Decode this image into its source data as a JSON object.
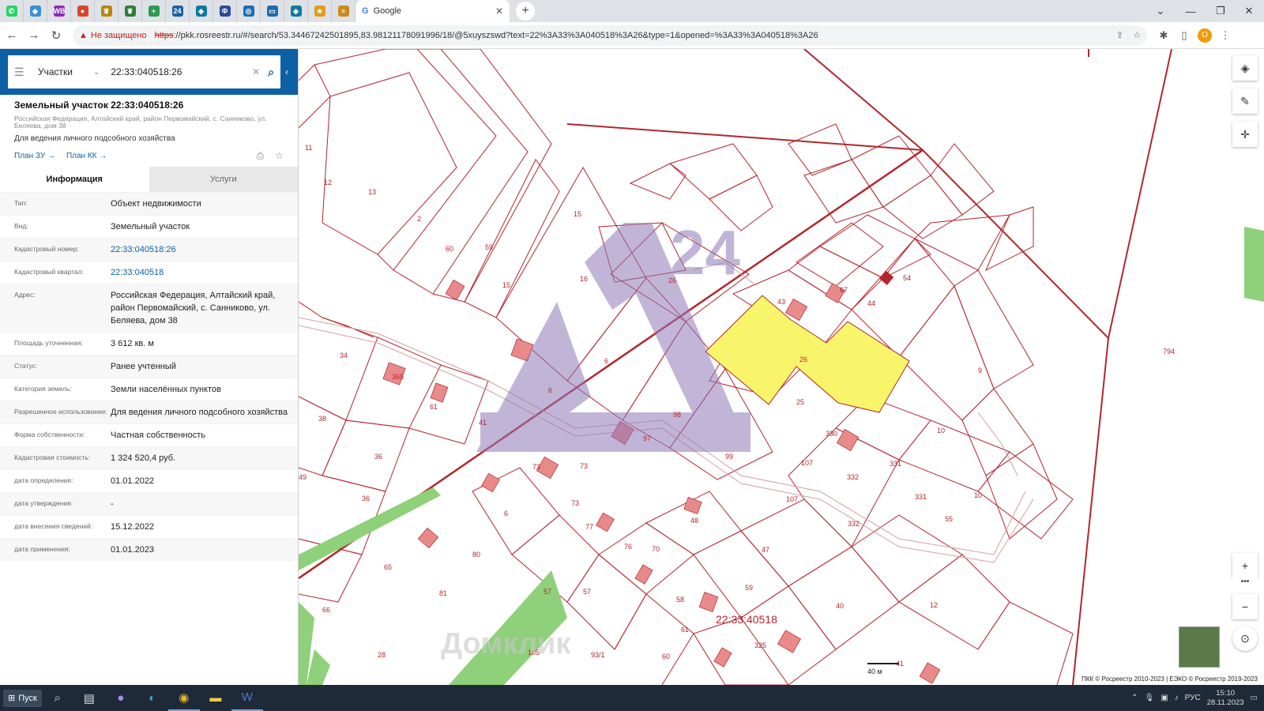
{
  "browser": {
    "tabs": [
      {
        "icon": "whatsapp-icon",
        "color": "#25d366",
        "glyph": "✆"
      },
      {
        "icon": "puzzle-icon",
        "color": "#3b8fd6",
        "glyph": "◆"
      },
      {
        "icon": "wb-icon",
        "color": "#8b2bb8",
        "glyph": "WB"
      },
      {
        "icon": "bookmark-icon",
        "color": "#d9452b",
        "glyph": "●"
      },
      {
        "icon": "emblem-icon",
        "color": "#b8860b",
        "glyph": "♛"
      },
      {
        "icon": "emblem-icon",
        "color": "#2e7d32",
        "glyph": "♛"
      },
      {
        "icon": "plus-icon",
        "color": "#2e9b4e",
        "glyph": "+"
      },
      {
        "icon": "24-icon",
        "color": "#1a5fa6",
        "glyph": "24"
      },
      {
        "icon": "shield-icon",
        "color": "#0d7a9c",
        "glyph": "◈"
      },
      {
        "icon": "doc-icon",
        "color": "#2b4a9c",
        "glyph": "Ф"
      },
      {
        "icon": "target-icon",
        "color": "#1a6db0",
        "glyph": "◎"
      },
      {
        "icon": "map-icon",
        "color": "#1a6db0",
        "glyph": "▭"
      },
      {
        "icon": "shield-icon",
        "color": "#0d7a9c",
        "glyph": "◈"
      },
      {
        "icon": "star-icon",
        "color": "#e39b1a",
        "glyph": "★"
      },
      {
        "icon": "stack-icon",
        "color": "#c98a1a",
        "glyph": "≡"
      }
    ],
    "active_tab_title": "Google",
    "insecure_label": "Не защищено",
    "url_scheme": "https",
    "url_rest": "://pkk.rosreestr.ru/#/search/53.34467242501895,83.98121178091996/18/@5xuyszswd?text=22%3A33%3A040518%3A26&type=1&opened=%3A33%3A040518%3A26",
    "profile_letter": "О"
  },
  "search": {
    "category": "Участки",
    "query": "22:33:040518:26"
  },
  "object": {
    "title": "Земельный участок 22:33:040518:26",
    "address_small": "Российская Федерация, Алтайский край, район Первомайский, с. Санниково, ул. Беляева, дом 38",
    "purpose": "Для ведения личного подсобного хозяйства",
    "link_plan_zu": "План ЗУ →",
    "link_plan_kk": "План КК →"
  },
  "tabs": {
    "info": "Информация",
    "services": "Услуги"
  },
  "info_rows": [
    {
      "k": "Тип:",
      "v": "Объект недвижимости"
    },
    {
      "k": "Вид:",
      "v": "Земельный участок"
    },
    {
      "k": "Кадастровый номер:",
      "v": "22:33:040518:26",
      "link": true
    },
    {
      "k": "Кадастровый квартал:",
      "v": "22:33:040518",
      "link": true
    },
    {
      "k": "Адрес:",
      "v": "Российская Федерация, Алтайский край, район Первомайский, с. Санниково, ул. Беляева, дом 38"
    },
    {
      "k": "Площадь уточненная:",
      "v": "3 612 кв. м"
    },
    {
      "k": "Статус:",
      "v": "Ранее учтенный"
    },
    {
      "k": "Категория земель:",
      "v": "Земли населённых пунктов"
    },
    {
      "k": "Разрешенное использование:",
      "v": "Для ведения личного подсобного хозяйства"
    },
    {
      "k": "Форма собственности:",
      "v": "Частная собственность"
    },
    {
      "k": "Кадастровая стоимость:",
      "v": "1 324 520,4 руб."
    },
    {
      "k": "дата определения:",
      "v": "01.01.2022"
    },
    {
      "k": "дата утверждения:",
      "v": "-"
    },
    {
      "k": "дата внесения сведений:",
      "v": "15.12.2022"
    },
    {
      "k": "дата применения:",
      "v": "01.01.2023"
    }
  ],
  "map": {
    "quarter_label": "22:33:40518",
    "scale_label": "40 м",
    "attribution": "ПКК © Росреестр 2010-2023 | ЕЭКО © Росреестр 2019-2023",
    "watermark": "Домклик",
    "selected_parcel": "26",
    "parcel_labels": [
      "11",
      "12",
      "13",
      "2",
      "60",
      "59",
      "15",
      "15",
      "16",
      "26",
      "43",
      "67",
      "54",
      "44",
      "9",
      "794",
      "34",
      "365",
      "61",
      "41",
      "6",
      "6",
      "98",
      "97",
      "25",
      "330",
      "10",
      "38",
      "36",
      "36",
      "49",
      "73",
      "73",
      "73",
      "77",
      "76",
      "70",
      "99",
      "107",
      "107",
      "332",
      "332",
      "331",
      "331",
      "10",
      "55",
      "48",
      "47",
      "65",
      "80",
      "6",
      "81",
      "57",
      "57",
      "59",
      "58",
      "61",
      "40",
      "12",
      "66",
      "28",
      "105",
      "93/1",
      "60",
      "325",
      "41"
    ]
  },
  "taskbar": {
    "start_label": "Пуск",
    "lang": "РУС",
    "time": "15:10",
    "date": "28.11.2023"
  }
}
